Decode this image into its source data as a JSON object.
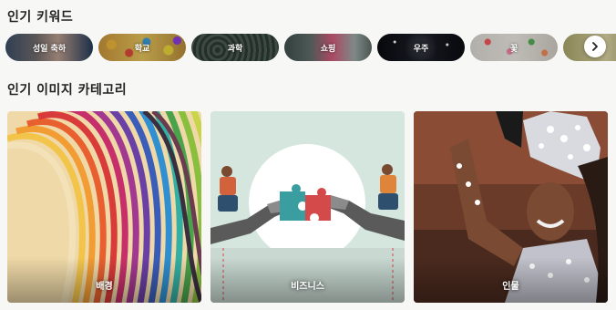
{
  "keywords_section": {
    "title": "인기 키워드",
    "items": [
      {
        "label": "성일 축하"
      },
      {
        "label": "학교"
      },
      {
        "label": "과학"
      },
      {
        "label": "쇼핑"
      },
      {
        "label": "우주"
      },
      {
        "label": "꽃"
      },
      {
        "label": ""
      }
    ],
    "next_icon": "chevron-right-icon"
  },
  "categories_section": {
    "title": "인기 이미지 카테고리",
    "cards": [
      {
        "label": "배경"
      },
      {
        "label": "비즈니스"
      },
      {
        "label": "인물"
      }
    ]
  }
}
